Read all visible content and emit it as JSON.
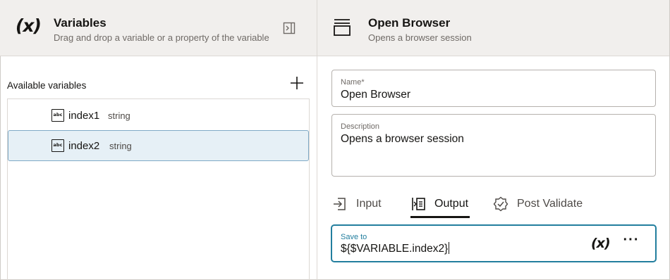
{
  "variables_panel": {
    "title": "Variables",
    "subtitle": "Drag and drop a variable or a property of the variable",
    "header_glyph": "(x)",
    "available_label": "Available variables",
    "items": [
      {
        "name": "index1",
        "type": "string",
        "icon": "abc-type-icon",
        "selected": false
      },
      {
        "name": "index2",
        "type": "string",
        "icon": "abc-type-icon",
        "selected": true
      }
    ]
  },
  "action_panel": {
    "title": "Open Browser",
    "subtitle": "Opens a browser session",
    "name_field": {
      "label": "Name*",
      "value": "Open Browser"
    },
    "description_field": {
      "label": "Description",
      "value": "Opens a browser session"
    },
    "tabs": [
      {
        "label": "Input",
        "icon": "input-icon",
        "active": false
      },
      {
        "label": "Output",
        "icon": "output-icon",
        "active": true
      },
      {
        "label": "Post Validate",
        "icon": "validate-icon",
        "active": false
      }
    ],
    "save_to": {
      "label": "Save to",
      "value": "${$VARIABLE.index2}",
      "variable_button": "(x)",
      "more_button": "···"
    }
  },
  "colors": {
    "header_bg": "#f1efed",
    "selected_row_bg": "#e6f0f6",
    "accent": "#227e9e"
  }
}
